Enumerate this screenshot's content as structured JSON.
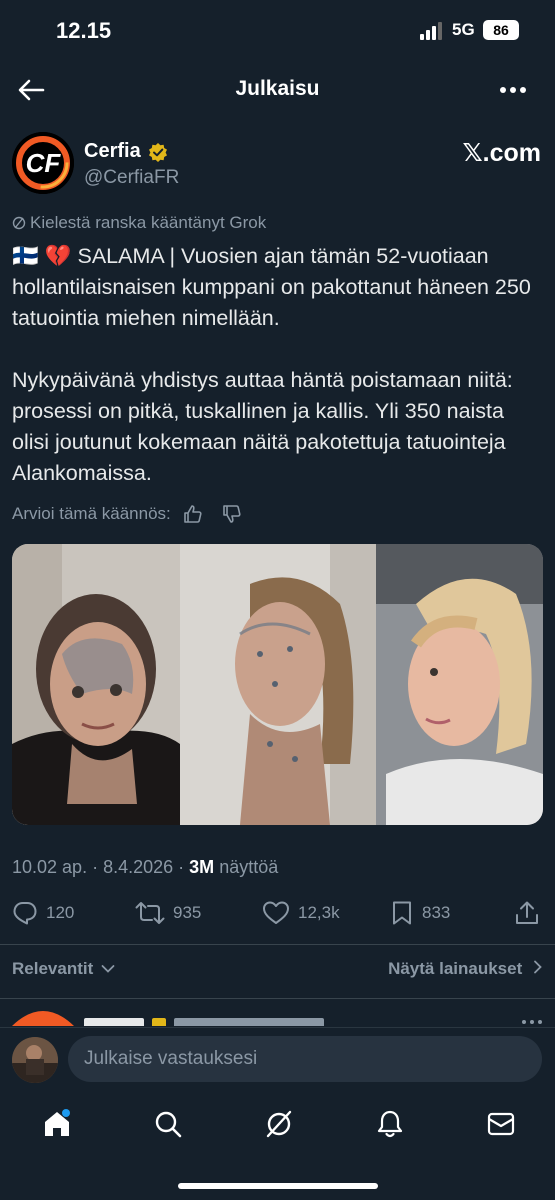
{
  "status": {
    "time": "12.15",
    "network": "5G",
    "battery": "86"
  },
  "header": {
    "title": "Julkaisu"
  },
  "post": {
    "author_name": "Cerfia",
    "author_handle": "@CerfiaFR",
    "logo_text": "CF",
    "source": "𝕏.com",
    "translated_note": "Kielestä ranska kääntänyt Grok",
    "text": "🇫🇮 💔 SALAMA | Vuosien ajan tämän 52-vuotiaan hollantilaisnaisen kumppani on pakottanut häneen 250 tatuointia miehen nimellään.\n\nNykypäivänä yhdistys auttaa häntä poistamaan niitä: prosessi on pitkä, tuskallinen ja kallis. Yli 350 naista olisi joutunut kokemaan näitä pakotettuja tatuointeja Alankomaissa.",
    "rate_label": "Arvioi tämä käännös:",
    "time": "10.02 ap.",
    "date": "8.4.2026",
    "views": "3M",
    "views_label": "näyttöä",
    "replies": "120",
    "reposts": "935",
    "likes": "12,3k",
    "bookmarks": "833"
  },
  "sort": {
    "relevance": "Relevantit",
    "quotes": "Näytä lainaukset"
  },
  "compose": {
    "placeholder": "Julkaise vastauksesi"
  },
  "colors": {
    "background": "#15202b",
    "accent": "#1d9bf0",
    "muted": "#8b98a5",
    "verified": "#e2b719"
  },
  "icons": [
    "back-arrow-icon",
    "more-icon",
    "verified-icon",
    "translate-icon",
    "thumbs-up-icon",
    "thumbs-down-icon",
    "reply-icon",
    "repost-icon",
    "like-icon",
    "bookmark-icon",
    "share-icon",
    "chevron-down-icon",
    "chevron-right-icon",
    "home-icon",
    "search-icon",
    "grok-icon",
    "notifications-icon",
    "messages-icon"
  ]
}
